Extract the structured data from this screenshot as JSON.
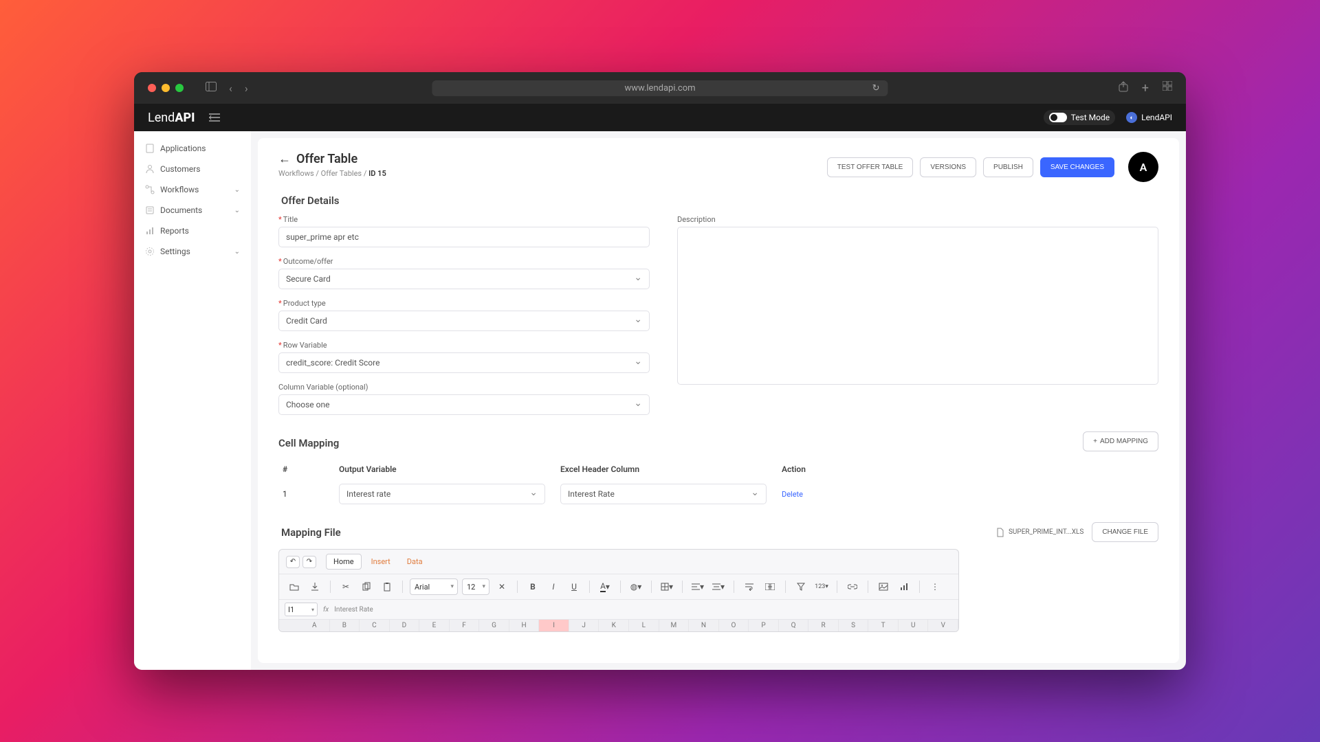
{
  "browser": {
    "url": "www.lendapi.com"
  },
  "appbar": {
    "brand_pre": "Lend",
    "brand_post": "API",
    "test_mode_label": "Test Mode",
    "org_label": "LendAPI"
  },
  "sidebar": {
    "items": [
      {
        "label": "Applications",
        "expandable": false
      },
      {
        "label": "Customers",
        "expandable": false
      },
      {
        "label": "Workflows",
        "expandable": true
      },
      {
        "label": "Documents",
        "expandable": true
      },
      {
        "label": "Reports",
        "expandable": false
      },
      {
        "label": "Settings",
        "expandable": true
      }
    ]
  },
  "page": {
    "title": "Offer Table",
    "breadcrumb": {
      "a": "Workflows",
      "b": "Offer Tables",
      "c": "ID 15"
    },
    "actions": {
      "test": "TEST OFFER TABLE",
      "versions": "VERSIONS",
      "publish": "PUBLISH",
      "save": "SAVE CHANGES"
    },
    "avatar": "A"
  },
  "details": {
    "heading": "Offer Details",
    "title_label": "Title",
    "title_value": "super_prime apr etc",
    "outcome_label": "Outcome/offer",
    "outcome_value": "Secure Card",
    "product_label": "Product type",
    "product_value": "Credit Card",
    "row_label": "Row Variable",
    "row_value": "credit_score: Credit Score",
    "col_label": "Column Variable (optional)",
    "col_value": "Choose one",
    "desc_label": "Description"
  },
  "mapping": {
    "heading": "Cell Mapping",
    "add_btn": "ADD MAPPING",
    "cols": {
      "num": "#",
      "out": "Output Variable",
      "excel": "Excel Header Column",
      "action": "Action"
    },
    "rows": [
      {
        "num": "1",
        "out": "Interest rate",
        "excel": "Interest Rate",
        "action": "Delete"
      }
    ]
  },
  "file": {
    "heading": "Mapping File",
    "name": "SUPER_PRIME_INT...XLS",
    "change_btn": "CHANGE FILE"
  },
  "spreadsheet": {
    "tabs": {
      "home": "Home",
      "insert": "Insert",
      "data": "Data"
    },
    "font_name": "Arial",
    "font_size": "12",
    "cell_ref": "I1",
    "fx_label": "fx",
    "formula_value": "Interest Rate",
    "columns": [
      "A",
      "B",
      "C",
      "D",
      "E",
      "F",
      "G",
      "H",
      "I",
      "J",
      "K",
      "L",
      "M",
      "N",
      "O",
      "P",
      "Q",
      "R",
      "S",
      "T",
      "U",
      "V"
    ],
    "selected_col": "I"
  }
}
